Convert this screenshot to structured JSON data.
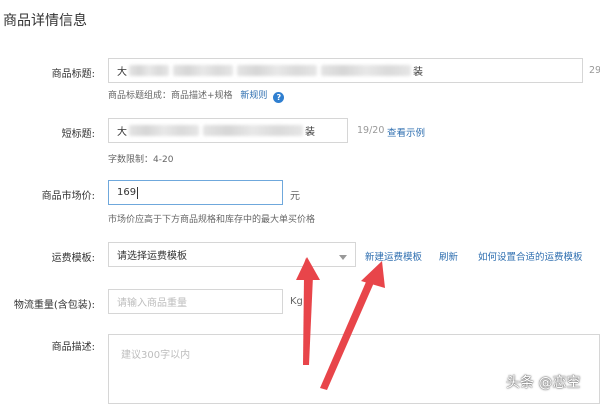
{
  "section_title": "商品详情信息",
  "fields": {
    "product_title": {
      "label": "商品标题:",
      "value_start": "大",
      "value_end": "装",
      "counter": "29",
      "hint": "商品标题组成：商品描述+规格",
      "hint_link": "新规则"
    },
    "short_title": {
      "label": "短标题:",
      "value_start": "大",
      "value_end": "装",
      "counter": "19/20",
      "counter_link": "查看示例",
      "hint": "字数限制：4-20"
    },
    "market_price": {
      "label": "商品市场价:",
      "value": "169",
      "unit": "元",
      "hint": "市场价应高于下方商品规格和库存中的最大单买价格"
    },
    "shipping_template": {
      "label": "运费模板:",
      "selected": "请选择运费模板",
      "links": [
        "新建运费模板",
        "刷新",
        "如何设置合适的运费模板"
      ]
    },
    "weight": {
      "label": "物流重量(含包装):",
      "placeholder": "请输入商品重量",
      "unit": "Kg"
    },
    "description": {
      "label": "商品描述:",
      "placeholder": "建议300字以内"
    }
  },
  "watermark": "头条 @恋空",
  "colors": {
    "link": "#2f6fb0",
    "arrow": "#e8454a",
    "focus_border": "#6fa8dc"
  },
  "icons": [
    "help-icon",
    "chevron-down-icon"
  ]
}
